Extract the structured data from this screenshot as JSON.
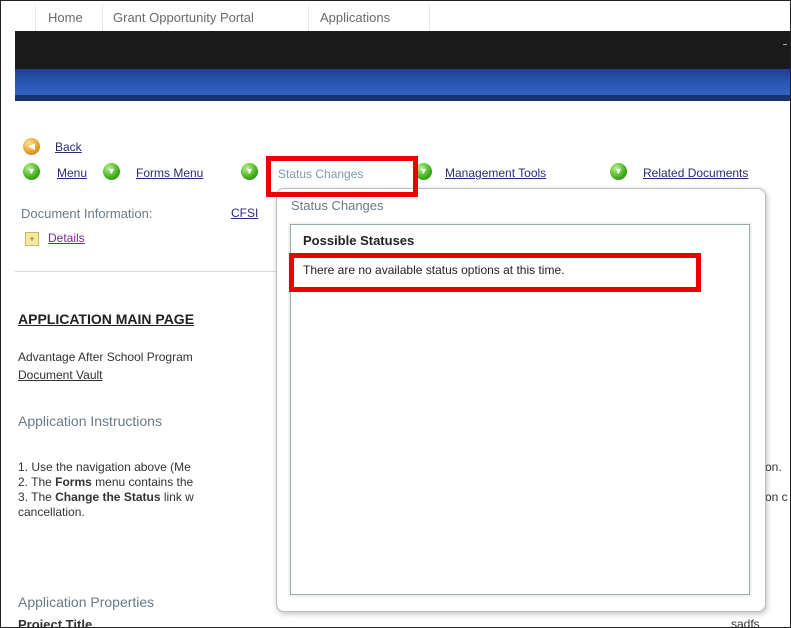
{
  "topnav": {
    "items": [
      "Home",
      "Grant Opportunity Portal",
      "Applications"
    ]
  },
  "nav": {
    "back": "Back",
    "menu": "Menu",
    "forms_menu": "Forms Menu",
    "status_changes": "Status Changes",
    "management_tools": "Management Tools",
    "related_documents": "Related Documents"
  },
  "document_info": {
    "label": "Document Information:",
    "code": "CFSI",
    "details": "Details"
  },
  "main": {
    "title": "APPLICATION MAIN PAGE",
    "program": "Advantage After School Program",
    "vault": "Document Vault",
    "instructions_heading": "Application Instructions",
    "instruction_1": "1. Use the navigation above (Me",
    "instruction_2_pre": "2. The ",
    "instruction_2_bold": "Forms",
    "instruction_2_post": " menu contains the",
    "instruction_3_pre": "3. The ",
    "instruction_3_bold": "Change the Status",
    "instruction_3_post": " link w",
    "instruction_3_cont": "cancellation.",
    "right_fragment_1": "on.",
    "right_fragment_3": "on c",
    "properties_heading": "Application Properties",
    "project_title": "Project Title",
    "project_value": "sadfs"
  },
  "popup": {
    "title": "Status Changes",
    "possible": "Possible Statuses",
    "message": "There are no available status options at this time."
  },
  "colors": {
    "highlight": "#ee0000",
    "band_dark": "#1b1b1b",
    "band_blue": "#2b58b4"
  }
}
